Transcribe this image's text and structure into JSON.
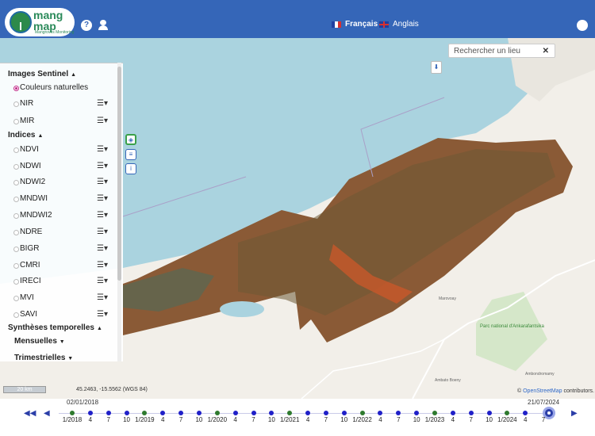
{
  "header": {
    "logo": {
      "line1": "mang",
      "line2": "map",
      "tagline": "Mangroves Monitoring"
    },
    "icons": {
      "help": "help-icon",
      "user": "user-icon",
      "globe": "globe-icon"
    },
    "help_label": "?",
    "languages": [
      {
        "label": "Français",
        "flag": "flag-fr-icon",
        "active": true
      },
      {
        "label": "Anglais",
        "flag": "flag-uk-icon",
        "active": false
      }
    ]
  },
  "search": {
    "placeholder": "Rechercher un lieu",
    "clear": "✕"
  },
  "panel": {
    "sentinel": {
      "title": "Images Sentinel",
      "items": [
        {
          "label": "Couleurs naturelles",
          "selected": true
        },
        {
          "label": "NIR",
          "selected": false
        },
        {
          "label": "MIR",
          "selected": false
        }
      ]
    },
    "indices": {
      "title": "Indices",
      "items": [
        "NDVI",
        "NDWI",
        "NDWI2",
        "MNDWI",
        "MNDWI2",
        "NDRE",
        "BIGR",
        "CMRI",
        "IRECI",
        "MVI",
        "SAVI"
      ]
    },
    "temporal": {
      "title": "Synthèses temporelles",
      "subs": [
        "Mensuelles",
        "Trimestrielles"
      ]
    },
    "menu_glyph": "☰▾"
  },
  "map": {
    "coords": "45.2463, -15.5562 (WGS 84)",
    "scale": "20 km",
    "attribution_prefix": "© ",
    "attribution_link": "OpenStreetMap",
    "attribution_suffix": " contributors.",
    "labels": [
      "Marovoay",
      "Parc national d'Ankarafantsika",
      "Ambondromamy",
      "Ambato Boeny"
    ],
    "colors": {
      "sea": "#aad3df",
      "land": "#f2efe9",
      "imagery": "#8a5a36",
      "accent": "#3566b8"
    }
  },
  "timeline": {
    "start_date": "02/01/2018",
    "end_date": "21/07/2024",
    "labels": [
      "1/2018",
      "4",
      "7",
      "10",
      "1/2019",
      "4",
      "7",
      "10",
      "1/2020",
      "4",
      "7",
      "10",
      "1/2021",
      "4",
      "7",
      "10",
      "1/2022",
      "4",
      "7",
      "10",
      "1/2023",
      "4",
      "7",
      "10",
      "1/2024",
      "4",
      "7"
    ],
    "dots": [
      "g",
      "b",
      "b",
      "b",
      "g",
      "b",
      "b",
      "b",
      "g",
      "b",
      "b",
      "b",
      "g",
      "b",
      "b",
      "b",
      "g",
      "b",
      "b",
      "b",
      "g",
      "b",
      "b",
      "b",
      "g",
      "b"
    ],
    "controls": {
      "first": "◀◀",
      "prev": "◀",
      "next": "▶"
    }
  }
}
